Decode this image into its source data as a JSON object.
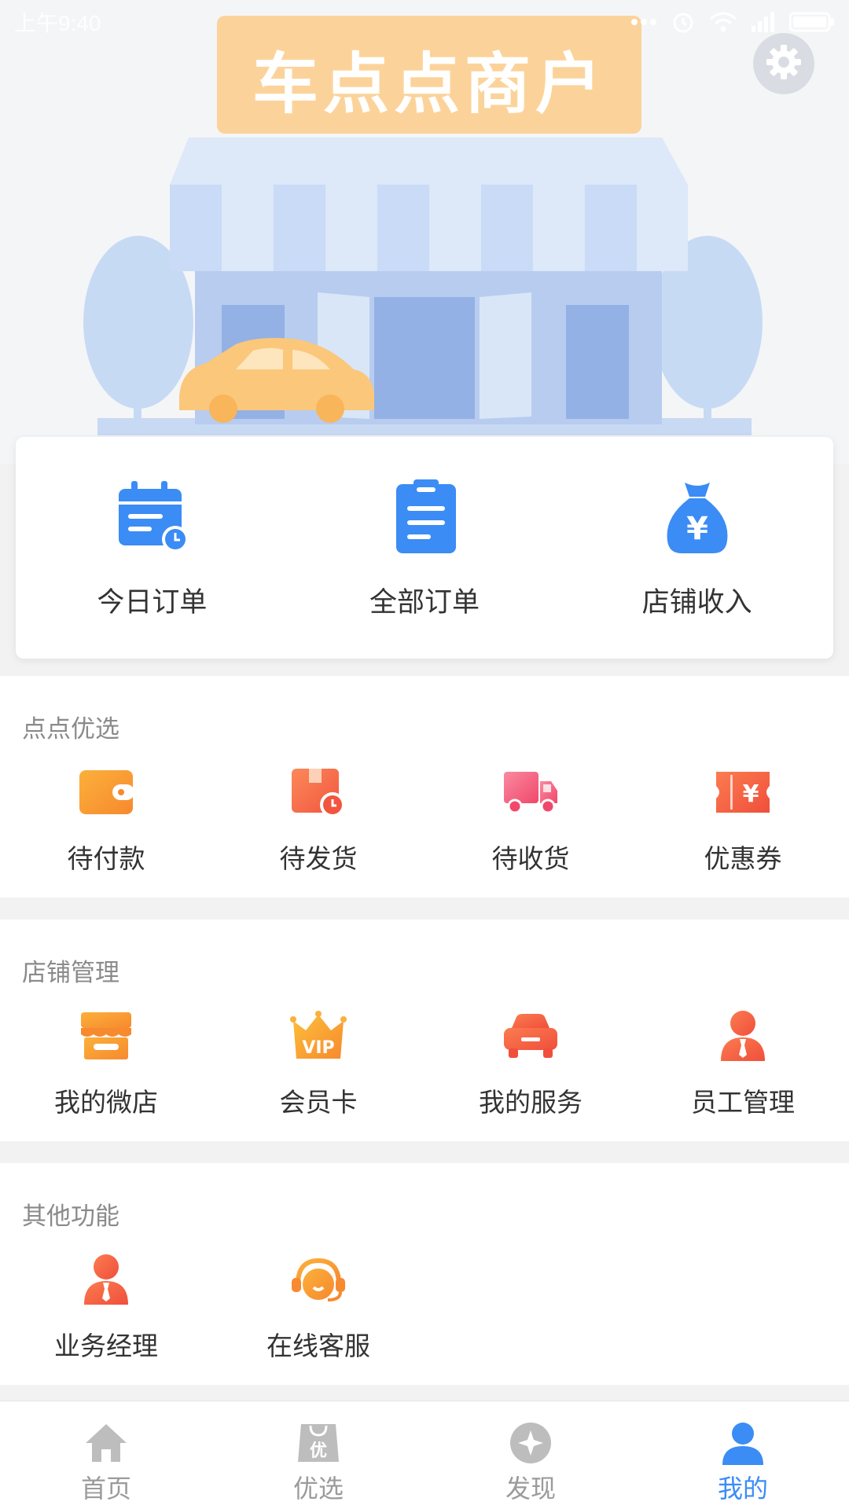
{
  "status_bar": {
    "time": "上午9:40"
  },
  "hero": {
    "sign": "车点点商户"
  },
  "quick_actions": [
    {
      "label": "今日订单",
      "icon": "calendar-clock-icon"
    },
    {
      "label": "全部订单",
      "icon": "clipboard-list-icon"
    },
    {
      "label": "店铺收入",
      "icon": "money-bag-icon"
    }
  ],
  "sections": [
    {
      "title": "点点优选",
      "items": [
        {
          "label": "待付款",
          "icon": "wallet-icon"
        },
        {
          "label": "待发货",
          "icon": "package-clock-icon"
        },
        {
          "label": "待收货",
          "icon": "truck-icon"
        },
        {
          "label": "优惠券",
          "icon": "coupon-icon"
        }
      ]
    },
    {
      "title": "店铺管理",
      "items": [
        {
          "label": "我的微店",
          "icon": "shop-icon"
        },
        {
          "label": "会员卡",
          "icon": "vip-crown-icon"
        },
        {
          "label": "我的服务",
          "icon": "car-icon"
        },
        {
          "label": "员工管理",
          "icon": "staff-icon"
        }
      ]
    },
    {
      "title": "其他功能",
      "items": [
        {
          "label": "业务经理",
          "icon": "manager-icon"
        },
        {
          "label": "在线客服",
          "icon": "headset-icon"
        }
      ]
    }
  ],
  "bottom_nav": [
    {
      "label": "首页",
      "icon": "home-icon",
      "active": false
    },
    {
      "label": "优选",
      "icon": "bag-icon",
      "active": false
    },
    {
      "label": "发现",
      "icon": "compass-icon",
      "active": false
    },
    {
      "label": "我的",
      "icon": "user-icon",
      "active": true
    }
  ],
  "colors": {
    "accent": "#3b8cf5",
    "orange": "#f7923a",
    "red_orange": "#f26a4a",
    "gray_text": "#8a8a8a"
  }
}
